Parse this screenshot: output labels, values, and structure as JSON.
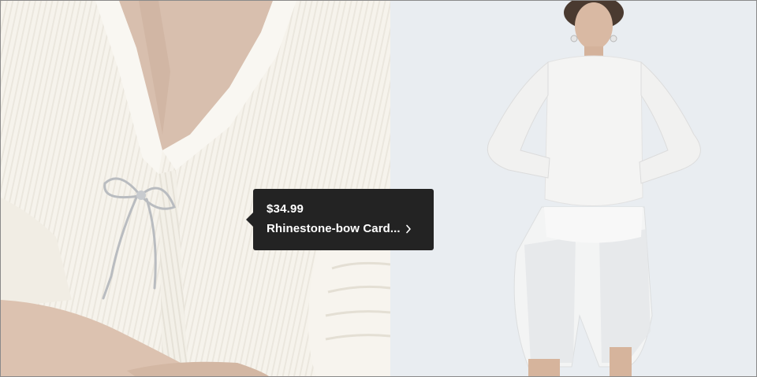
{
  "product_tooltip": {
    "price": "$34.99",
    "name": "Rhinestone-bow Card..."
  },
  "icons": {
    "tooltip_arrow": "chevron-right-icon"
  },
  "colors": {
    "tooltip_background": "#232323",
    "tooltip_text": "#ffffff",
    "left_panel_background": "#f4f1ea",
    "right_panel_background": "#e9edf1"
  }
}
